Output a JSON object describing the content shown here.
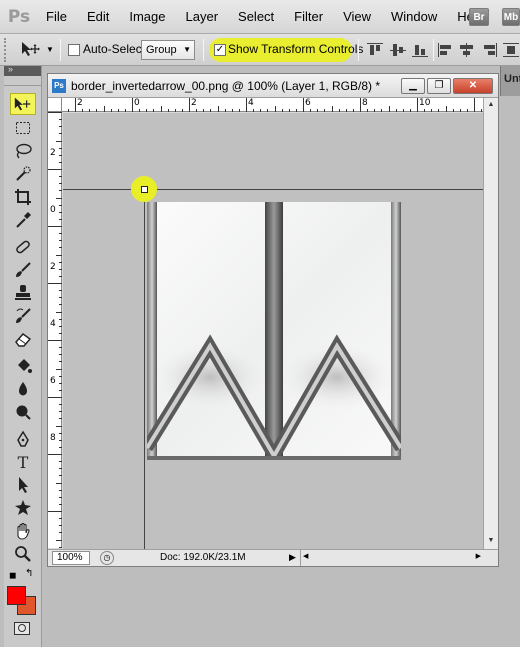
{
  "app": {
    "logo": "Ps"
  },
  "menu": [
    "File",
    "Edit",
    "Image",
    "Layer",
    "Select",
    "Filter",
    "View",
    "Window",
    "Help"
  ],
  "app_icons": {
    "bridge": "Br",
    "mini_bridge": "Mb"
  },
  "options_bar": {
    "auto_select_label": "Auto-Select:",
    "auto_select_checked": false,
    "auto_select_value": "Group",
    "show_transform_label": "Show Transform Controls",
    "show_transform_checked": true,
    "checkmark": "✓"
  },
  "document": {
    "title": "border_invertedarrow_00.png @ 100% (Layer 1, RGB/8) *",
    "ps_badge": "Ps",
    "zoom": "100%",
    "doc_info": "Doc: 192.0K/23.1M",
    "ruler_top": [
      "2",
      "0",
      "2",
      "4",
      "6",
      "8",
      "10"
    ],
    "ruler_left": [
      "2",
      "0",
      "2",
      "4",
      "6",
      "8"
    ]
  },
  "tools": [
    "move-tool",
    "marquee-tool",
    "lasso-tool",
    "quick-select-tool",
    "crop-tool",
    "eyedropper-tool",
    "healing-brush-tool",
    "brush-tool",
    "clone-stamp-tool",
    "history-brush-tool",
    "eraser-tool",
    "paint-bucket-tool",
    "blur-tool",
    "dodge-tool",
    "pen-tool",
    "type-tool",
    "path-select-tool",
    "custom-shape-tool",
    "hand-tool",
    "zoom-tool"
  ],
  "right_panel": {
    "label": "Unt"
  },
  "colors": {
    "foreground": "#ff0000",
    "background": "#e0572e",
    "highlight": "#e9ef26"
  }
}
